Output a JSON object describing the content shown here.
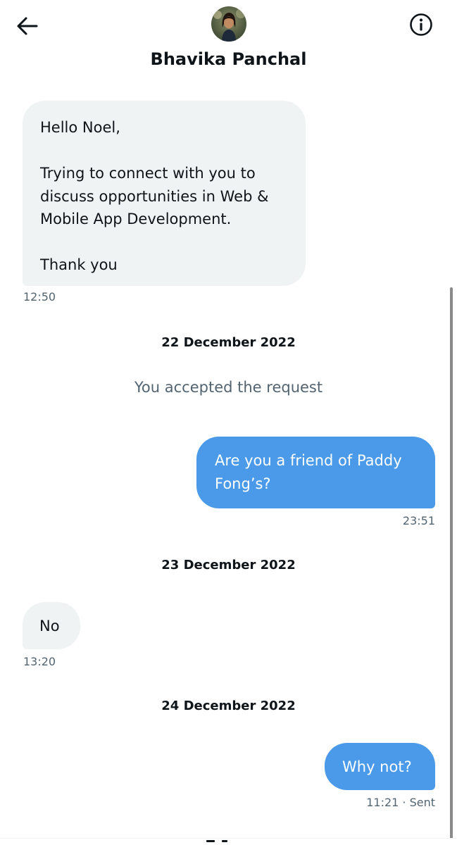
{
  "header": {
    "contact_name": "Bhavika Panchal",
    "back_icon": "arrow-left-icon",
    "info_icon": "info-circle-icon",
    "avatar_icon": "profile-photo"
  },
  "messages": [
    {
      "direction": "received",
      "lines": [
        "Hello Noel,",
        "Trying to connect with you to",
        "discuss opportunities in Web &",
        "Mobile App Development.",
        "Thank you"
      ],
      "time": "12:50"
    },
    {
      "direction": "sent",
      "lines": [
        "Are you a friend of Paddy",
        "Fong’s?"
      ],
      "time": "23:51"
    },
    {
      "direction": "received",
      "lines": [
        "No"
      ],
      "time": "13:20"
    },
    {
      "direction": "sent",
      "lines": [
        "Why not?"
      ],
      "time": "11:21",
      "status": "· Sent"
    }
  ],
  "date_separators": [
    "22 December 2022",
    "23 December 2022",
    "24 December 2022"
  ],
  "system_note": "You accepted the request",
  "colors": {
    "sent_bubble": "#4a9ae9",
    "received_bubble": "#eff3f4",
    "secondary_text": "#536471",
    "primary_text": "#0f1419"
  }
}
